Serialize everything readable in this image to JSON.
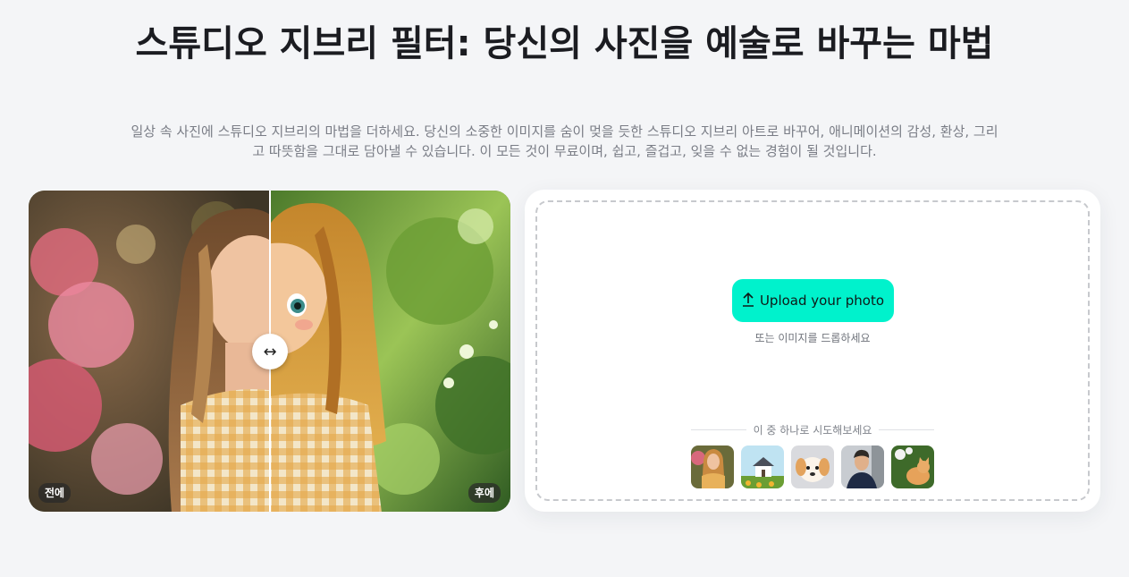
{
  "hero": {
    "title": "스튜디오 지브리 필터: 당신의 사진을 예술로 바꾸는 마법",
    "subtitle": "일상 속 사진에 스튜디오 지브리의 마법을 더하세요. 당신의 소중한 이미지를 숨이 멎을 듯한 스튜디오 지브리 아트로 바꾸어, 애니메이션의 감성, 환상, 그리고 따뜻함을 그대로 담아낼 수 있습니다. 이 모든 것이 무료이며, 쉽고, 즐겁고, 잊을 수 없는 경험이 될 것입니다."
  },
  "compare": {
    "before_label": "전에",
    "after_label": "후에",
    "handle_icon": "↔"
  },
  "upload": {
    "button_label": "Upload your photo",
    "button_icon": "upload-arrow-icon",
    "button_color": "#00f2cc",
    "drop_hint": "또는 이미지를 드롭하세요",
    "samples_label": "이 중 하나로 시도해보세요",
    "samples": [
      {
        "name": "sample-girl-thumbnail"
      },
      {
        "name": "sample-house-thumbnail"
      },
      {
        "name": "sample-puppy-thumbnail"
      },
      {
        "name": "sample-man-thumbnail"
      },
      {
        "name": "sample-cat-thumbnail"
      }
    ]
  }
}
